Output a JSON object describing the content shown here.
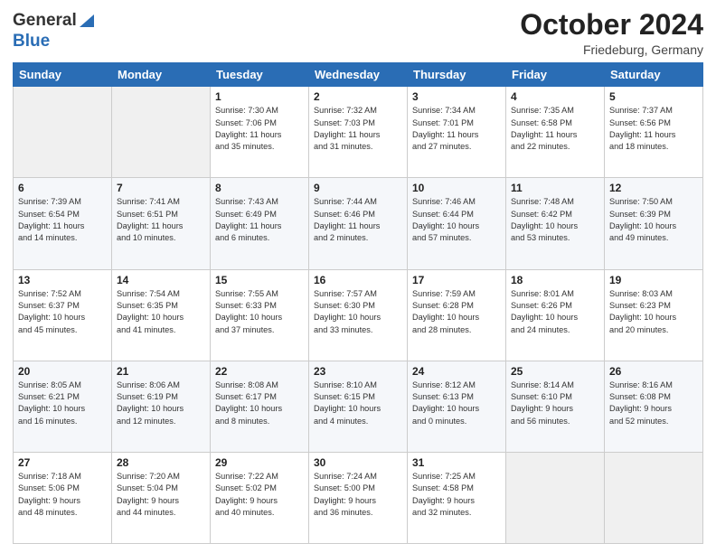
{
  "header": {
    "logo_general": "General",
    "logo_blue": "Blue",
    "month_title": "October 2024",
    "location": "Friedeburg, Germany"
  },
  "days_of_week": [
    "Sunday",
    "Monday",
    "Tuesday",
    "Wednesday",
    "Thursday",
    "Friday",
    "Saturday"
  ],
  "weeks": [
    [
      {
        "day": "",
        "info": ""
      },
      {
        "day": "",
        "info": ""
      },
      {
        "day": "1",
        "info": "Sunrise: 7:30 AM\nSunset: 7:06 PM\nDaylight: 11 hours\nand 35 minutes."
      },
      {
        "day": "2",
        "info": "Sunrise: 7:32 AM\nSunset: 7:03 PM\nDaylight: 11 hours\nand 31 minutes."
      },
      {
        "day": "3",
        "info": "Sunrise: 7:34 AM\nSunset: 7:01 PM\nDaylight: 11 hours\nand 27 minutes."
      },
      {
        "day": "4",
        "info": "Sunrise: 7:35 AM\nSunset: 6:58 PM\nDaylight: 11 hours\nand 22 minutes."
      },
      {
        "day": "5",
        "info": "Sunrise: 7:37 AM\nSunset: 6:56 PM\nDaylight: 11 hours\nand 18 minutes."
      }
    ],
    [
      {
        "day": "6",
        "info": "Sunrise: 7:39 AM\nSunset: 6:54 PM\nDaylight: 11 hours\nand 14 minutes."
      },
      {
        "day": "7",
        "info": "Sunrise: 7:41 AM\nSunset: 6:51 PM\nDaylight: 11 hours\nand 10 minutes."
      },
      {
        "day": "8",
        "info": "Sunrise: 7:43 AM\nSunset: 6:49 PM\nDaylight: 11 hours\nand 6 minutes."
      },
      {
        "day": "9",
        "info": "Sunrise: 7:44 AM\nSunset: 6:46 PM\nDaylight: 11 hours\nand 2 minutes."
      },
      {
        "day": "10",
        "info": "Sunrise: 7:46 AM\nSunset: 6:44 PM\nDaylight: 10 hours\nand 57 minutes."
      },
      {
        "day": "11",
        "info": "Sunrise: 7:48 AM\nSunset: 6:42 PM\nDaylight: 10 hours\nand 53 minutes."
      },
      {
        "day": "12",
        "info": "Sunrise: 7:50 AM\nSunset: 6:39 PM\nDaylight: 10 hours\nand 49 minutes."
      }
    ],
    [
      {
        "day": "13",
        "info": "Sunrise: 7:52 AM\nSunset: 6:37 PM\nDaylight: 10 hours\nand 45 minutes."
      },
      {
        "day": "14",
        "info": "Sunrise: 7:54 AM\nSunset: 6:35 PM\nDaylight: 10 hours\nand 41 minutes."
      },
      {
        "day": "15",
        "info": "Sunrise: 7:55 AM\nSunset: 6:33 PM\nDaylight: 10 hours\nand 37 minutes."
      },
      {
        "day": "16",
        "info": "Sunrise: 7:57 AM\nSunset: 6:30 PM\nDaylight: 10 hours\nand 33 minutes."
      },
      {
        "day": "17",
        "info": "Sunrise: 7:59 AM\nSunset: 6:28 PM\nDaylight: 10 hours\nand 28 minutes."
      },
      {
        "day": "18",
        "info": "Sunrise: 8:01 AM\nSunset: 6:26 PM\nDaylight: 10 hours\nand 24 minutes."
      },
      {
        "day": "19",
        "info": "Sunrise: 8:03 AM\nSunset: 6:23 PM\nDaylight: 10 hours\nand 20 minutes."
      }
    ],
    [
      {
        "day": "20",
        "info": "Sunrise: 8:05 AM\nSunset: 6:21 PM\nDaylight: 10 hours\nand 16 minutes."
      },
      {
        "day": "21",
        "info": "Sunrise: 8:06 AM\nSunset: 6:19 PM\nDaylight: 10 hours\nand 12 minutes."
      },
      {
        "day": "22",
        "info": "Sunrise: 8:08 AM\nSunset: 6:17 PM\nDaylight: 10 hours\nand 8 minutes."
      },
      {
        "day": "23",
        "info": "Sunrise: 8:10 AM\nSunset: 6:15 PM\nDaylight: 10 hours\nand 4 minutes."
      },
      {
        "day": "24",
        "info": "Sunrise: 8:12 AM\nSunset: 6:13 PM\nDaylight: 10 hours\nand 0 minutes."
      },
      {
        "day": "25",
        "info": "Sunrise: 8:14 AM\nSunset: 6:10 PM\nDaylight: 9 hours\nand 56 minutes."
      },
      {
        "day": "26",
        "info": "Sunrise: 8:16 AM\nSunset: 6:08 PM\nDaylight: 9 hours\nand 52 minutes."
      }
    ],
    [
      {
        "day": "27",
        "info": "Sunrise: 7:18 AM\nSunset: 5:06 PM\nDaylight: 9 hours\nand 48 minutes."
      },
      {
        "day": "28",
        "info": "Sunrise: 7:20 AM\nSunset: 5:04 PM\nDaylight: 9 hours\nand 44 minutes."
      },
      {
        "day": "29",
        "info": "Sunrise: 7:22 AM\nSunset: 5:02 PM\nDaylight: 9 hours\nand 40 minutes."
      },
      {
        "day": "30",
        "info": "Sunrise: 7:24 AM\nSunset: 5:00 PM\nDaylight: 9 hours\nand 36 minutes."
      },
      {
        "day": "31",
        "info": "Sunrise: 7:25 AM\nSunset: 4:58 PM\nDaylight: 9 hours\nand 32 minutes."
      },
      {
        "day": "",
        "info": ""
      },
      {
        "day": "",
        "info": ""
      }
    ]
  ]
}
